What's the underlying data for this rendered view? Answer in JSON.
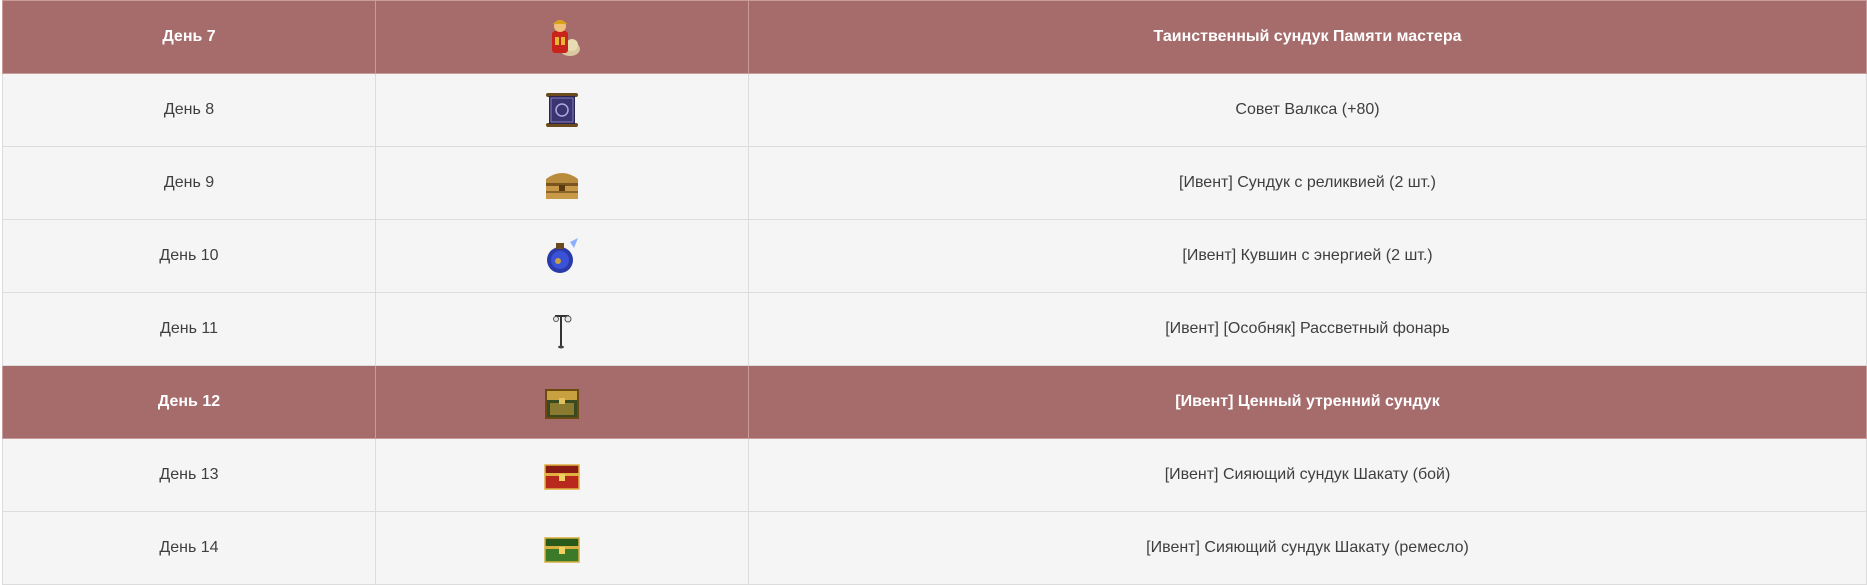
{
  "rows": [
    {
      "day": "День 7",
      "reward": "Таинственный сундук Памяти мастера",
      "icon": "gift-character-icon",
      "highlight": true
    },
    {
      "day": "День 8",
      "reward": "Совет Валкса (+80)",
      "icon": "scroll-icon",
      "highlight": false
    },
    {
      "day": "День 9",
      "reward": "[Ивент] Сундук с реликвией (2 шт.)",
      "icon": "relic-chest-icon",
      "highlight": false
    },
    {
      "day": "День 10",
      "reward": "[Ивент] Кувшин с энергией (2 шт.)",
      "icon": "energy-jug-icon",
      "highlight": false
    },
    {
      "day": "День 11",
      "reward": "[Ивент] [Особняк] Рассветный фонарь",
      "icon": "street-lamp-icon",
      "highlight": false
    },
    {
      "day": "День 12",
      "reward": "[Ивент] Ценный утренний сундук",
      "icon": "morning-chest-icon",
      "highlight": true
    },
    {
      "day": "День 13",
      "reward": "[Ивент] Сияющий сундук Шакату (бой)",
      "icon": "red-chest-icon",
      "highlight": false
    },
    {
      "day": "День 14",
      "reward": "[Ивент] Сияющий сундук Шакату (ремесло)",
      "icon": "green-chest-icon",
      "highlight": false
    }
  ],
  "colors": {
    "highlight_row": "#a66c6c",
    "normal_row": "#f5f5f5",
    "text": "#3f3f3f"
  }
}
